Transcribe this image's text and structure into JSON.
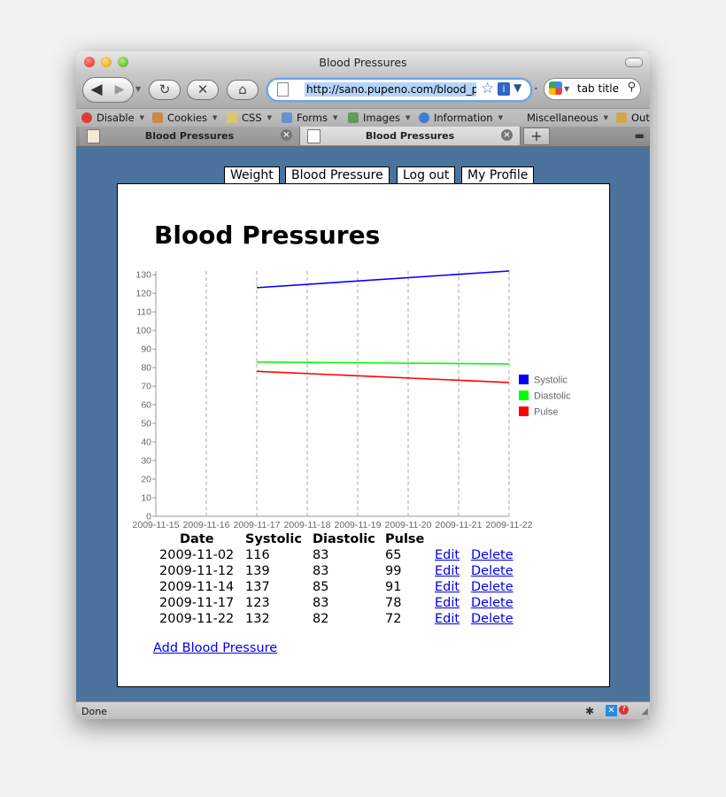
{
  "window": {
    "title": "Blood Pressures"
  },
  "toolbar": {
    "url": "http://sano.pupeno.com/blood_pressures",
    "search_text": "tab title"
  },
  "bookmarks": [
    "Disable",
    "Cookies",
    "CSS",
    "Forms",
    "Images",
    "Information",
    "Miscellaneous",
    "Out"
  ],
  "tabs": [
    {
      "label": "Blood Pressures",
      "active": false
    },
    {
      "label": "Blood Pressures",
      "active": true
    }
  ],
  "status": {
    "text": "Done"
  },
  "nav": {
    "links": [
      "Weight",
      "Blood Pressure",
      "Log out",
      "My Profile"
    ]
  },
  "page": {
    "title": "Blood Pressures"
  },
  "chart_data": {
    "type": "line",
    "title": "",
    "xlabel": "",
    "ylabel": "",
    "x_ticks": [
      "2009-11-15",
      "2009-11-16",
      "2009-11-17",
      "2009-11-18",
      "2009-11-19",
      "2009-11-20",
      "2009-11-21",
      "2009-11-22"
    ],
    "y_ticks": [
      0,
      10,
      20,
      30,
      40,
      50,
      60,
      70,
      80,
      90,
      100,
      110,
      120,
      130
    ],
    "ylim": [
      0,
      132
    ],
    "grid": "vertical dashed",
    "legend_position": "right",
    "series": [
      {
        "name": "Systolic",
        "color": "#0000ff",
        "x": [
          "2009-11-17",
          "2009-11-22"
        ],
        "y": [
          123,
          132
        ]
      },
      {
        "name": "Diastolic",
        "color": "#00ff00",
        "x": [
          "2009-11-17",
          "2009-11-22"
        ],
        "y": [
          83,
          82
        ]
      },
      {
        "name": "Pulse",
        "color": "#ff0000",
        "x": [
          "2009-11-17",
          "2009-11-22"
        ],
        "y": [
          78,
          72
        ]
      }
    ]
  },
  "table": {
    "headers": [
      "Date",
      "Systolic",
      "Diastolic",
      "Pulse"
    ],
    "rows": [
      {
        "date": "2009-11-02",
        "systolic": "116",
        "diastolic": "83",
        "pulse": "65"
      },
      {
        "date": "2009-11-12",
        "systolic": "139",
        "diastolic": "83",
        "pulse": "99"
      },
      {
        "date": "2009-11-14",
        "systolic": "137",
        "diastolic": "85",
        "pulse": "91"
      },
      {
        "date": "2009-11-17",
        "systolic": "123",
        "diastolic": "83",
        "pulse": "78"
      },
      {
        "date": "2009-11-22",
        "systolic": "132",
        "diastolic": "82",
        "pulse": "72"
      }
    ],
    "edit_label": "Edit",
    "delete_label": "Delete"
  },
  "add_link": "Add Blood Pressure"
}
